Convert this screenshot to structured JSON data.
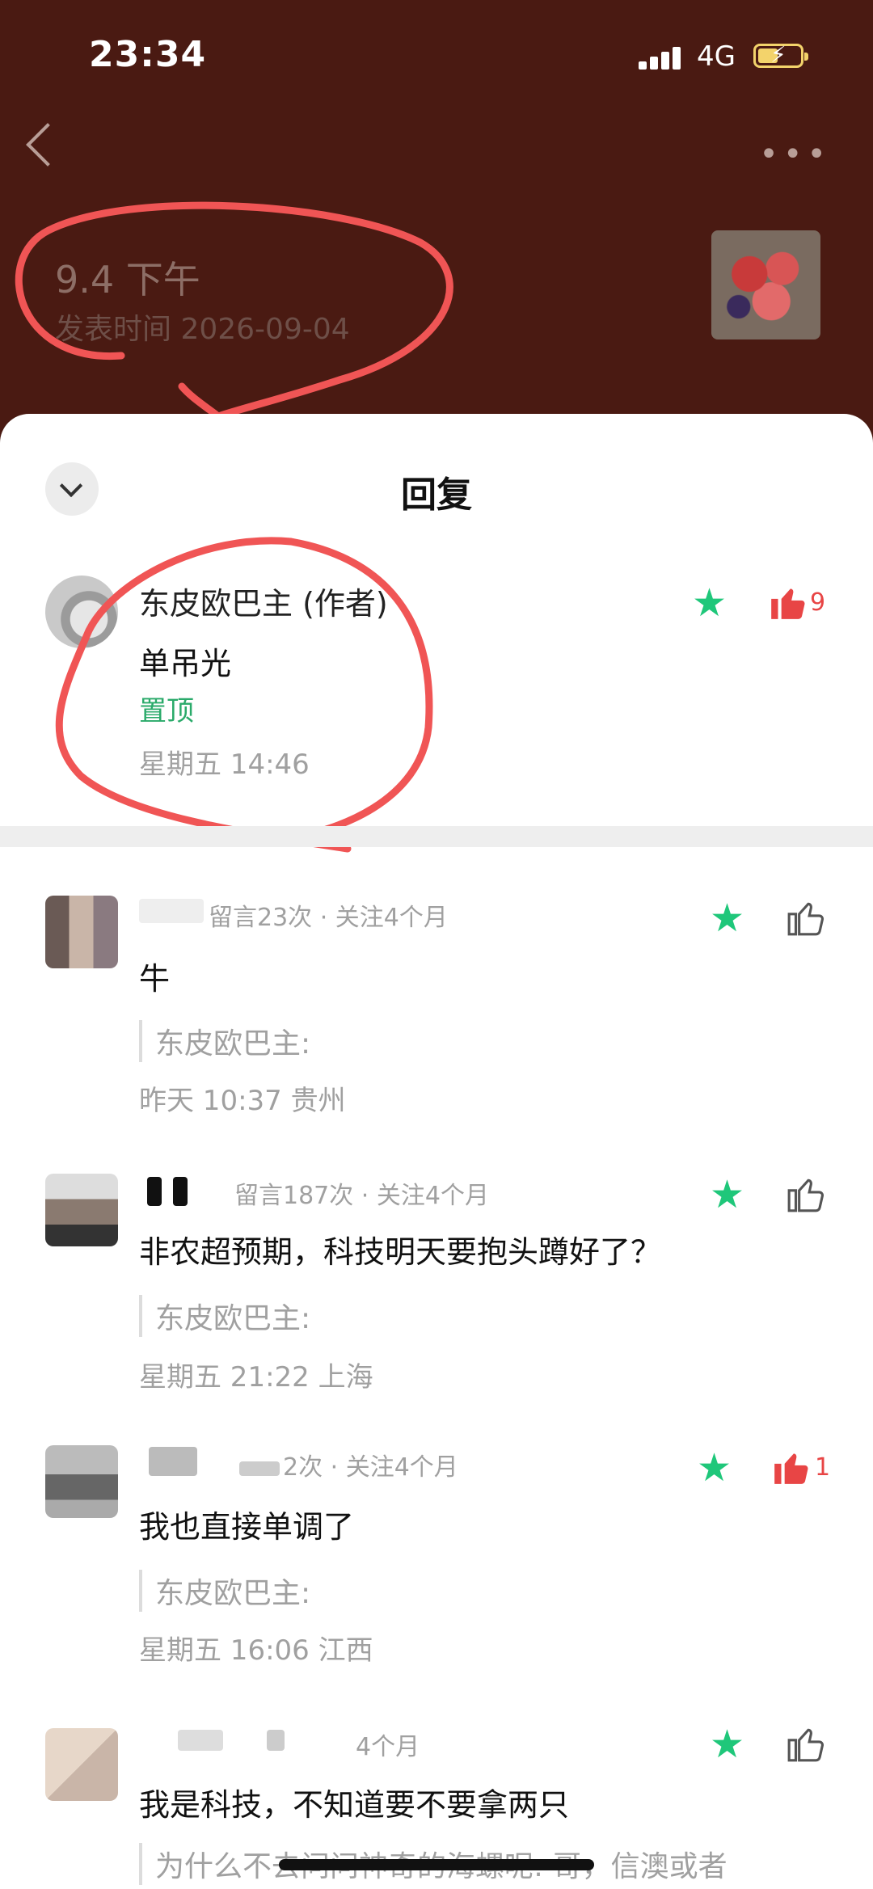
{
  "status_bar": {
    "time": "23:34",
    "network": "4G"
  },
  "header": {
    "title": "9.4 下午",
    "publish_time": "发表时间 2026-09-04"
  },
  "sheet": {
    "title": "回复"
  },
  "main_comment": {
    "author": "东皮欧巴主 (作者)",
    "content": "单吊光",
    "pinned": "置顶",
    "time": "星期五 14:46",
    "likes": "9"
  },
  "replies": [
    {
      "meta": "留言23次 · 关注4个月",
      "content": "牛",
      "quote": "东皮欧巴主:",
      "time": "昨天 10:37  贵州"
    },
    {
      "meta": "留言187次 · 关注4个月",
      "content": "非农超预期，科技明天要抱头蹲好了？",
      "quote": "东皮欧巴主:",
      "time": "星期五 21:22  上海"
    },
    {
      "meta": "2次 · 关注4个月",
      "content": "我也直接单调了",
      "quote": "东皮欧巴主:",
      "time": "星期五 16:06  江西",
      "likes": "1"
    },
    {
      "meta": "4个月",
      "content": "我是科技，不知道要不要拿两只",
      "quote": "为什么不去问问神奇的海螺呢: 哥，信澳或者"
    }
  ],
  "colors": {
    "accent": "#1fc77a",
    "like": "#e84545",
    "header_bg": "#4a1a12",
    "annotation": "#f05555"
  }
}
